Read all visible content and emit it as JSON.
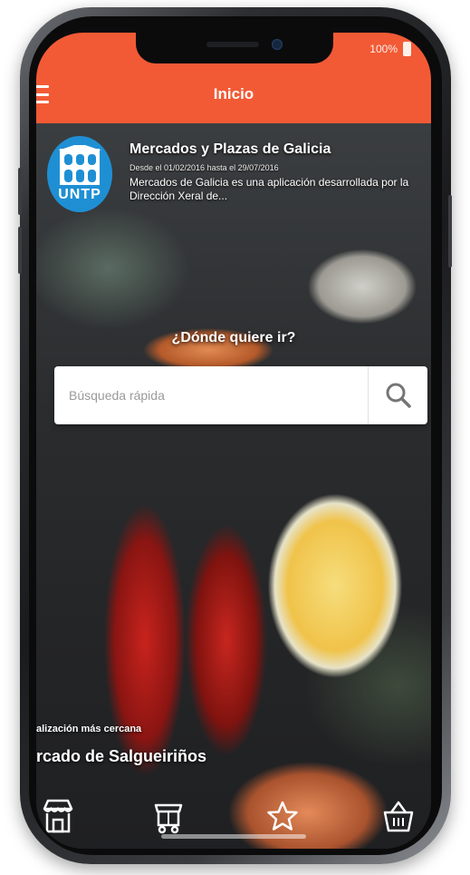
{
  "status_bar": {
    "battery_text": "100%"
  },
  "app_bar": {
    "title": "Inicio"
  },
  "news_card": {
    "logo_text": "UNTP",
    "title": "Mercados y Plazas de Galicia",
    "dates": "Desde el 01/02/2016 hasta el 29/07/2016",
    "description": "Mercados de Galicia es una aplicación desarrollada por la Dirección Xeral de..."
  },
  "search": {
    "heading": "¿Dónde quiere ir?",
    "placeholder": "Búsqueda rápida"
  },
  "nearest": {
    "label": "alización más cercana",
    "name": "rcado de Salgueiriños"
  },
  "bottom_nav": {
    "items": [
      "market-icon",
      "cart-icon",
      "star-icon",
      "basket-icon"
    ]
  },
  "colors": {
    "accent": "#f25a35",
    "logo_blue": "#1f8fd4"
  }
}
